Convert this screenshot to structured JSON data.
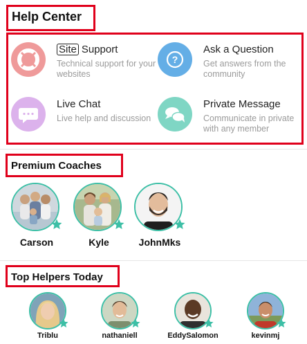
{
  "help_center": {
    "title": "Help Center",
    "items": [
      {
        "id": "support",
        "tag": "Site",
        "title": "Support",
        "desc": "Technical support for your websites",
        "icon": "lifebuoy-icon",
        "color": "#ef9a9a"
      },
      {
        "id": "ask",
        "title": "Ask a Question",
        "desc": "Get answers from the community",
        "icon": "question-icon",
        "color": "#64aee6"
      },
      {
        "id": "livechat",
        "title": "Live Chat",
        "desc": "Live help and discussion",
        "icon": "chat-bubble-icon",
        "color": "#dcb2ec"
      },
      {
        "id": "private",
        "title": "Private Message",
        "desc": "Communicate in private with any member",
        "icon": "speech-bubbles-icon",
        "color": "#7fd6c4"
      }
    ]
  },
  "premium_coaches": {
    "title": "Premium Coaches",
    "people": [
      {
        "name": "Carson",
        "photo": "family-group-photo"
      },
      {
        "name": "Kyle",
        "photo": "couple-with-child-photo"
      },
      {
        "name": "JohnMks",
        "photo": "smiling-bearded-man-photo"
      }
    ]
  },
  "top_helpers": {
    "title": "Top Helpers Today",
    "people": [
      {
        "name": "Triblu",
        "photo": "blonde-woman-photo"
      },
      {
        "name": "nathaniell",
        "photo": "young-man-photo"
      },
      {
        "name": "EddySalomon",
        "photo": "bald-man-photo"
      },
      {
        "name": "kevinmj",
        "photo": "man-outdoors-photo"
      }
    ]
  },
  "colors": {
    "highlight_border": "#e0001b",
    "avatar_ring": "#3dbfa6",
    "star_badge": "#3dbfa6",
    "description_text": "#9a9a9a"
  }
}
